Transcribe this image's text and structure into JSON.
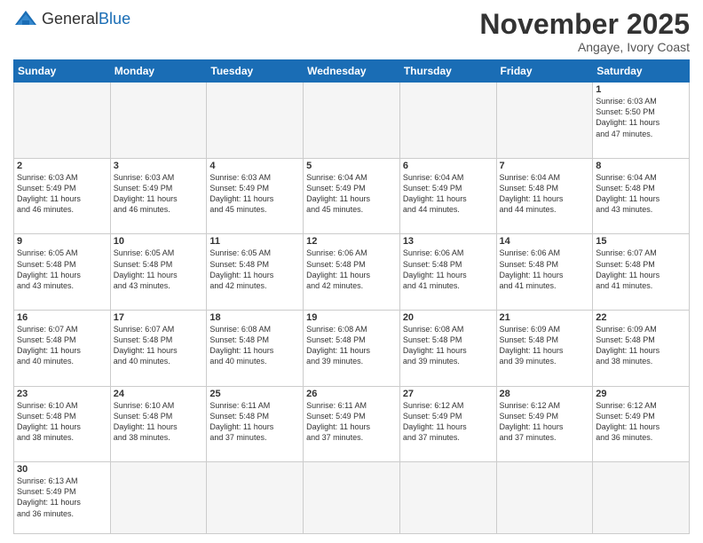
{
  "header": {
    "logo_general": "General",
    "logo_blue": "Blue",
    "month_title": "November 2025",
    "location": "Angaye, Ivory Coast"
  },
  "weekdays": [
    "Sunday",
    "Monday",
    "Tuesday",
    "Wednesday",
    "Thursday",
    "Friday",
    "Saturday"
  ],
  "weeks": [
    [
      {
        "day": "",
        "info": ""
      },
      {
        "day": "",
        "info": ""
      },
      {
        "day": "",
        "info": ""
      },
      {
        "day": "",
        "info": ""
      },
      {
        "day": "",
        "info": ""
      },
      {
        "day": "",
        "info": ""
      },
      {
        "day": "1",
        "info": "Sunrise: 6:03 AM\nSunset: 5:50 PM\nDaylight: 11 hours\nand 47 minutes."
      }
    ],
    [
      {
        "day": "2",
        "info": "Sunrise: 6:03 AM\nSunset: 5:49 PM\nDaylight: 11 hours\nand 46 minutes."
      },
      {
        "day": "3",
        "info": "Sunrise: 6:03 AM\nSunset: 5:49 PM\nDaylight: 11 hours\nand 46 minutes."
      },
      {
        "day": "4",
        "info": "Sunrise: 6:03 AM\nSunset: 5:49 PM\nDaylight: 11 hours\nand 45 minutes."
      },
      {
        "day": "5",
        "info": "Sunrise: 6:04 AM\nSunset: 5:49 PM\nDaylight: 11 hours\nand 45 minutes."
      },
      {
        "day": "6",
        "info": "Sunrise: 6:04 AM\nSunset: 5:49 PM\nDaylight: 11 hours\nand 44 minutes."
      },
      {
        "day": "7",
        "info": "Sunrise: 6:04 AM\nSunset: 5:48 PM\nDaylight: 11 hours\nand 44 minutes."
      },
      {
        "day": "8",
        "info": "Sunrise: 6:04 AM\nSunset: 5:48 PM\nDaylight: 11 hours\nand 43 minutes."
      }
    ],
    [
      {
        "day": "9",
        "info": "Sunrise: 6:05 AM\nSunset: 5:48 PM\nDaylight: 11 hours\nand 43 minutes."
      },
      {
        "day": "10",
        "info": "Sunrise: 6:05 AM\nSunset: 5:48 PM\nDaylight: 11 hours\nand 43 minutes."
      },
      {
        "day": "11",
        "info": "Sunrise: 6:05 AM\nSunset: 5:48 PM\nDaylight: 11 hours\nand 42 minutes."
      },
      {
        "day": "12",
        "info": "Sunrise: 6:06 AM\nSunset: 5:48 PM\nDaylight: 11 hours\nand 42 minutes."
      },
      {
        "day": "13",
        "info": "Sunrise: 6:06 AM\nSunset: 5:48 PM\nDaylight: 11 hours\nand 41 minutes."
      },
      {
        "day": "14",
        "info": "Sunrise: 6:06 AM\nSunset: 5:48 PM\nDaylight: 11 hours\nand 41 minutes."
      },
      {
        "day": "15",
        "info": "Sunrise: 6:07 AM\nSunset: 5:48 PM\nDaylight: 11 hours\nand 41 minutes."
      }
    ],
    [
      {
        "day": "16",
        "info": "Sunrise: 6:07 AM\nSunset: 5:48 PM\nDaylight: 11 hours\nand 40 minutes."
      },
      {
        "day": "17",
        "info": "Sunrise: 6:07 AM\nSunset: 5:48 PM\nDaylight: 11 hours\nand 40 minutes."
      },
      {
        "day": "18",
        "info": "Sunrise: 6:08 AM\nSunset: 5:48 PM\nDaylight: 11 hours\nand 40 minutes."
      },
      {
        "day": "19",
        "info": "Sunrise: 6:08 AM\nSunset: 5:48 PM\nDaylight: 11 hours\nand 39 minutes."
      },
      {
        "day": "20",
        "info": "Sunrise: 6:08 AM\nSunset: 5:48 PM\nDaylight: 11 hours\nand 39 minutes."
      },
      {
        "day": "21",
        "info": "Sunrise: 6:09 AM\nSunset: 5:48 PM\nDaylight: 11 hours\nand 39 minutes."
      },
      {
        "day": "22",
        "info": "Sunrise: 6:09 AM\nSunset: 5:48 PM\nDaylight: 11 hours\nand 38 minutes."
      }
    ],
    [
      {
        "day": "23",
        "info": "Sunrise: 6:10 AM\nSunset: 5:48 PM\nDaylight: 11 hours\nand 38 minutes."
      },
      {
        "day": "24",
        "info": "Sunrise: 6:10 AM\nSunset: 5:48 PM\nDaylight: 11 hours\nand 38 minutes."
      },
      {
        "day": "25",
        "info": "Sunrise: 6:11 AM\nSunset: 5:48 PM\nDaylight: 11 hours\nand 37 minutes."
      },
      {
        "day": "26",
        "info": "Sunrise: 6:11 AM\nSunset: 5:49 PM\nDaylight: 11 hours\nand 37 minutes."
      },
      {
        "day": "27",
        "info": "Sunrise: 6:12 AM\nSunset: 5:49 PM\nDaylight: 11 hours\nand 37 minutes."
      },
      {
        "day": "28",
        "info": "Sunrise: 6:12 AM\nSunset: 5:49 PM\nDaylight: 11 hours\nand 37 minutes."
      },
      {
        "day": "29",
        "info": "Sunrise: 6:12 AM\nSunset: 5:49 PM\nDaylight: 11 hours\nand 36 minutes."
      }
    ],
    [
      {
        "day": "30",
        "info": "Sunrise: 6:13 AM\nSunset: 5:49 PM\nDaylight: 11 hours\nand 36 minutes."
      },
      {
        "day": "",
        "info": ""
      },
      {
        "day": "",
        "info": ""
      },
      {
        "day": "",
        "info": ""
      },
      {
        "day": "",
        "info": ""
      },
      {
        "day": "",
        "info": ""
      },
      {
        "day": "",
        "info": ""
      }
    ]
  ]
}
